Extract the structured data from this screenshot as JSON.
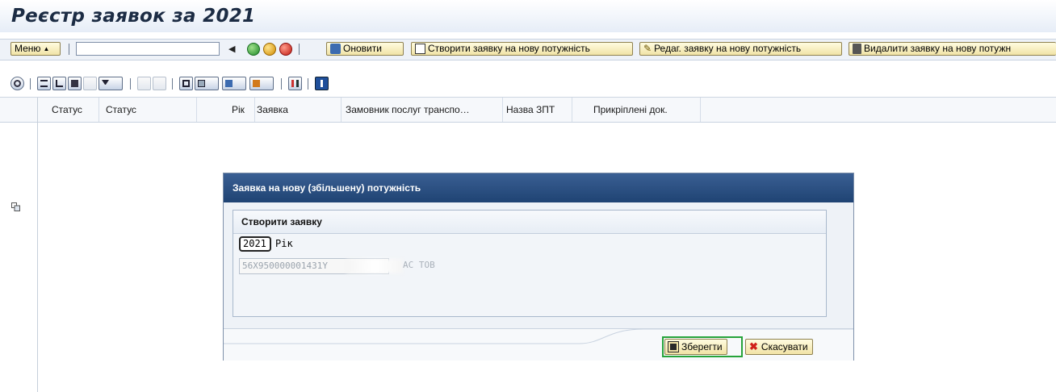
{
  "window": {
    "title": "Реєстр заявок за 2021"
  },
  "toolbar": {
    "menu_label": "Меню",
    "command_field_value": "",
    "refresh_label": "Оновити",
    "create_label": "Створити заявку на нову потужність",
    "edit_label": "Редаг. заявку на нову потужність",
    "delete_label": "Видалити заявку на нову потужн"
  },
  "grid": {
    "columns": [
      "Статус",
      "Статус",
      "Рік",
      "Заявка",
      "Замовник послуг транспо…",
      "Назва ЗПТ",
      "Прикріплені док."
    ]
  },
  "dialog": {
    "title": "Заявка на нову (збільшену) потужність",
    "group_title": "Створити заявку",
    "year_value": "2021",
    "year_label": "Рік",
    "customer_value": "56X950000001431Y",
    "customer_suffix": "АС ТОВ",
    "save_label": "Зберегти",
    "cancel_label": "Скасувати"
  },
  "colors": {
    "accent": "#1f4373",
    "button_bg": "#f1e3a6",
    "highlight": "#26a33a"
  }
}
